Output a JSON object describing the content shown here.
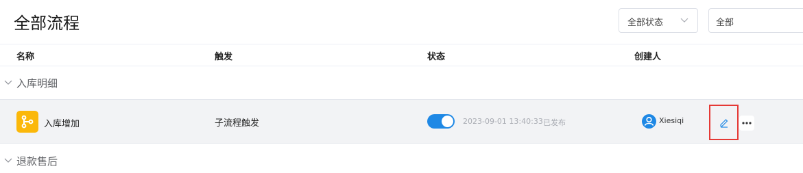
{
  "header": {
    "title": "全部流程",
    "status_filter": "全部状态",
    "type_filter": "全部"
  },
  "columns": {
    "name": "名称",
    "trigger": "触发",
    "status": "状态",
    "creator": "创建人"
  },
  "groups": [
    {
      "label": "入库明细",
      "expanded": true,
      "rows": [
        {
          "name": "入库增加",
          "trigger": "子流程触发",
          "enabled": true,
          "published_at": "2023-09-01 13:40:33",
          "publish_status": "已发布",
          "creator": "Xiesiqi"
        }
      ]
    },
    {
      "label": "退款售后",
      "expanded": false
    }
  ],
  "colors": {
    "accent": "#1e88e5",
    "flow_icon_bg": "#fbb80a",
    "highlight": "#e53935"
  },
  "icons": {
    "flow": "branch-icon",
    "edit": "pencil-icon",
    "more": "ellipsis-icon",
    "avatar": "user-icon",
    "caret": "chevron-down-icon"
  }
}
